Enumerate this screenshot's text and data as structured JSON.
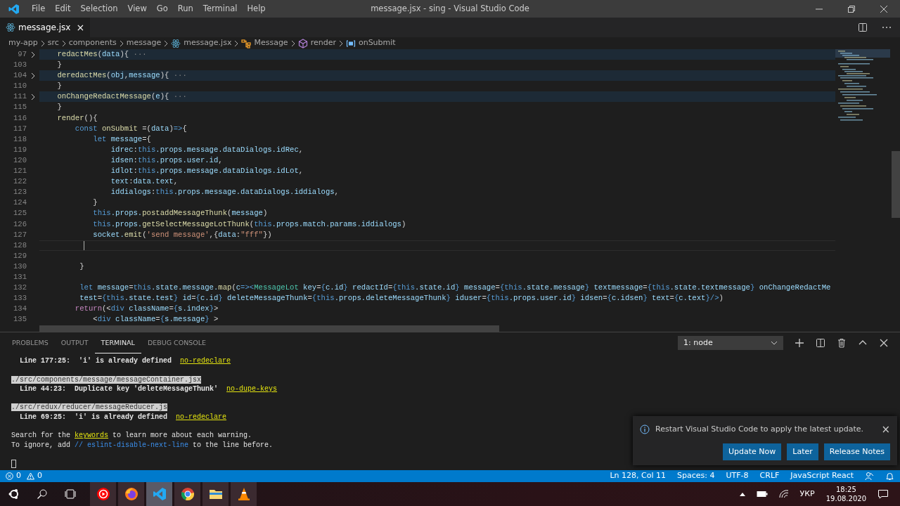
{
  "window": {
    "title": "message.jsx - sing - Visual Studio Code"
  },
  "menu": [
    "File",
    "Edit",
    "Selection",
    "View",
    "Go",
    "Run",
    "Terminal",
    "Help"
  ],
  "tabs": [
    {
      "label": "message.jsx",
      "selected": true,
      "close": "×"
    }
  ],
  "breadcrumbs": [
    {
      "label": "my-app"
    },
    {
      "label": "src"
    },
    {
      "label": "components"
    },
    {
      "label": "message"
    },
    {
      "label": "message.jsx",
      "kind": "react"
    },
    {
      "label": "Message",
      "kind": "class"
    },
    {
      "label": "render",
      "kind": "method"
    },
    {
      "label": "onSubmit",
      "kind": "variable"
    }
  ],
  "code": [
    {
      "number": "97",
      "folded": true,
      "tokens": [
        {
          "kind": "fn",
          "text": "    redactMes"
        },
        {
          "kind": "p",
          "text": "("
        },
        {
          "kind": "var",
          "text": "data"
        },
        {
          "kind": "p",
          "text": "){"
        },
        {
          "kind": "dots",
          "text": " ···"
        }
      ]
    },
    {
      "number": "103",
      "folded": false,
      "tokens": [
        {
          "kind": "p",
          "text": "    }"
        }
      ]
    },
    {
      "number": "104",
      "folded": true,
      "tokens": [
        {
          "kind": "fn",
          "text": "    deredactMes"
        },
        {
          "kind": "p",
          "text": "("
        },
        {
          "kind": "var",
          "text": "obj"
        },
        {
          "kind": "p",
          "text": ","
        },
        {
          "kind": "var",
          "text": "message"
        },
        {
          "kind": "p",
          "text": "){"
        },
        {
          "kind": "dots",
          "text": " ···"
        }
      ]
    },
    {
      "number": "110",
      "folded": false,
      "tokens": [
        {
          "kind": "p",
          "text": "    }"
        }
      ]
    },
    {
      "number": "111",
      "folded": true,
      "tokens": [
        {
          "kind": "fn",
          "text": "    onChangeRedactMessage"
        },
        {
          "kind": "p",
          "text": "("
        },
        {
          "kind": "var",
          "text": "e"
        },
        {
          "kind": "p",
          "text": "){"
        },
        {
          "kind": "dots",
          "text": " ···"
        }
      ]
    },
    {
      "number": "115",
      "folded": false,
      "tokens": [
        {
          "kind": "p",
          "text": "    }"
        }
      ]
    },
    {
      "number": "116",
      "folded": false,
      "tokens": [
        {
          "kind": "fn",
          "text": "    render"
        },
        {
          "kind": "p",
          "text": "(){"
        }
      ]
    },
    {
      "number": "117",
      "folded": false,
      "tokens": [
        {
          "kind": "kw",
          "text": "        const"
        },
        {
          "kind": "fn",
          "text": " onSubmit"
        },
        {
          "kind": "p",
          "text": " =("
        },
        {
          "kind": "var",
          "text": "data"
        },
        {
          "kind": "p",
          "text": ")"
        },
        {
          "kind": "kw",
          "text": "=>"
        },
        {
          "kind": "p",
          "text": "{"
        }
      ]
    },
    {
      "number": "118",
      "folded": false,
      "tokens": [
        {
          "kind": "kw",
          "text": "            let"
        },
        {
          "kind": "var",
          "text": " message"
        },
        {
          "kind": "p",
          "text": "={"
        }
      ]
    },
    {
      "number": "119",
      "folded": false,
      "tokens": [
        {
          "kind": "var",
          "text": "                idrec"
        },
        {
          "kind": "p",
          "text": ":"
        },
        {
          "kind": "kw",
          "text": "this"
        },
        {
          "kind": "var",
          "text": ".props.message.dataDialogs.idRec"
        },
        {
          "kind": "p",
          "text": ","
        }
      ]
    },
    {
      "number": "120",
      "folded": false,
      "tokens": [
        {
          "kind": "var",
          "text": "                idsen"
        },
        {
          "kind": "p",
          "text": ":"
        },
        {
          "kind": "kw",
          "text": "this"
        },
        {
          "kind": "var",
          "text": ".props.user.id"
        },
        {
          "kind": "p",
          "text": ","
        }
      ]
    },
    {
      "number": "121",
      "folded": false,
      "tokens": [
        {
          "kind": "var",
          "text": "                idlot"
        },
        {
          "kind": "p",
          "text": ":"
        },
        {
          "kind": "kw",
          "text": "this"
        },
        {
          "kind": "var",
          "text": ".props.message.dataDialogs.idLot"
        },
        {
          "kind": "p",
          "text": ","
        }
      ]
    },
    {
      "number": "122",
      "folded": false,
      "tokens": [
        {
          "kind": "var",
          "text": "                text"
        },
        {
          "kind": "p",
          "text": ":"
        },
        {
          "kind": "var",
          "text": "data.text"
        },
        {
          "kind": "p",
          "text": ","
        }
      ]
    },
    {
      "number": "123",
      "folded": false,
      "tokens": [
        {
          "kind": "var",
          "text": "                iddialogs"
        },
        {
          "kind": "p",
          "text": ":"
        },
        {
          "kind": "kw",
          "text": "this"
        },
        {
          "kind": "var",
          "text": ".props.message.dataDialogs.iddialogs"
        },
        {
          "kind": "p",
          "text": ","
        }
      ]
    },
    {
      "number": "124",
      "folded": false,
      "tokens": [
        {
          "kind": "p",
          "text": "            }"
        }
      ]
    },
    {
      "number": "125",
      "folded": false,
      "tokens": [
        {
          "kind": "kw",
          "text": "            this"
        },
        {
          "kind": "var",
          "text": ".props."
        },
        {
          "kind": "fn",
          "text": "postaddMessageThunk"
        },
        {
          "kind": "p",
          "text": "("
        },
        {
          "kind": "var",
          "text": "message"
        },
        {
          "kind": "p",
          "text": ")"
        }
      ]
    },
    {
      "number": "126",
      "folded": false,
      "tokens": [
        {
          "kind": "kw",
          "text": "            this"
        },
        {
          "kind": "var",
          "text": ".props."
        },
        {
          "kind": "fn",
          "text": "getSelectMessageLotThunk"
        },
        {
          "kind": "p",
          "text": "("
        },
        {
          "kind": "kw",
          "text": "this"
        },
        {
          "kind": "var",
          "text": ".props.match.params.iddialogs"
        },
        {
          "kind": "p",
          "text": ")"
        }
      ]
    },
    {
      "number": "127",
      "folded": false,
      "tokens": [
        {
          "kind": "var",
          "text": "            socket."
        },
        {
          "kind": "fn",
          "text": "emit"
        },
        {
          "kind": "p",
          "text": "("
        },
        {
          "kind": "str",
          "text": "'send message'"
        },
        {
          "kind": "p",
          "text": ",{"
        },
        {
          "kind": "var",
          "text": "data"
        },
        {
          "kind": "p",
          "text": ":"
        },
        {
          "kind": "str",
          "text": "\"fff\""
        },
        {
          "kind": "p",
          "text": "})"
        }
      ]
    },
    {
      "number": "128",
      "folded": false,
      "current": true
    },
    {
      "number": "129",
      "folded": false
    },
    {
      "number": "130",
      "folded": false,
      "tokens": [
        {
          "kind": "p",
          "text": "         }"
        }
      ]
    },
    {
      "number": "131",
      "folded": false
    },
    {
      "number": "132",
      "folded": false,
      "tokens": [
        {
          "kind": "kw",
          "text": "         let"
        },
        {
          "kind": "var",
          "text": " message"
        },
        {
          "kind": "p",
          "text": "="
        },
        {
          "kind": "kw",
          "text": "this"
        },
        {
          "kind": "var",
          "text": ".state.message."
        },
        {
          "kind": "fn",
          "text": "map"
        },
        {
          "kind": "p",
          "text": "("
        },
        {
          "kind": "var",
          "text": "c"
        },
        {
          "kind": "kw",
          "text": "=><"
        },
        {
          "kind": "tag",
          "text": "MessageLot"
        },
        {
          "kind": "var",
          "text": " key"
        },
        {
          "kind": "p",
          "text": "="
        },
        {
          "kind": "kw",
          "text": "{"
        },
        {
          "kind": "var",
          "text": "c.id"
        },
        {
          "kind": "kw",
          "text": "}"
        },
        {
          "kind": "var",
          "text": " redactId"
        },
        {
          "kind": "p",
          "text": "="
        },
        {
          "kind": "kw",
          "text": "{this"
        },
        {
          "kind": "var",
          "text": ".state.id"
        },
        {
          "kind": "kw",
          "text": "}"
        },
        {
          "kind": "var",
          "text": " message"
        },
        {
          "kind": "p",
          "text": "="
        },
        {
          "kind": "kw",
          "text": "{this"
        },
        {
          "kind": "var",
          "text": ".state.message"
        },
        {
          "kind": "kw",
          "text": "}"
        },
        {
          "kind": "var",
          "text": " textmessage"
        },
        {
          "kind": "p",
          "text": "="
        },
        {
          "kind": "kw",
          "text": "{this"
        },
        {
          "kind": "var",
          "text": ".state.textmessage"
        },
        {
          "kind": "kw",
          "text": "}"
        },
        {
          "kind": "var",
          "text": " onChangeRedactMe"
        }
      ]
    },
    {
      "number": "133",
      "folded": false,
      "tokens": [
        {
          "kind": "var",
          "text": "         test"
        },
        {
          "kind": "p",
          "text": "="
        },
        {
          "kind": "kw",
          "text": "{this"
        },
        {
          "kind": "var",
          "text": ".state.test"
        },
        {
          "kind": "kw",
          "text": "}"
        },
        {
          "kind": "var",
          "text": " id"
        },
        {
          "kind": "p",
          "text": "="
        },
        {
          "kind": "kw",
          "text": "{"
        },
        {
          "kind": "var",
          "text": "c.id"
        },
        {
          "kind": "kw",
          "text": "}"
        },
        {
          "kind": "var",
          "text": " deleteMessageThunk"
        },
        {
          "kind": "p",
          "text": "="
        },
        {
          "kind": "kw",
          "text": "{this"
        },
        {
          "kind": "var",
          "text": ".props.deleteMessageThunk"
        },
        {
          "kind": "kw",
          "text": "}"
        },
        {
          "kind": "var",
          "text": " iduser"
        },
        {
          "kind": "p",
          "text": "="
        },
        {
          "kind": "kw",
          "text": "{this"
        },
        {
          "kind": "var",
          "text": ".props.user.id"
        },
        {
          "kind": "kw",
          "text": "}"
        },
        {
          "kind": "var",
          "text": " idsen"
        },
        {
          "kind": "p",
          "text": "="
        },
        {
          "kind": "kw",
          "text": "{"
        },
        {
          "kind": "var",
          "text": "c.idsen"
        },
        {
          "kind": "kw",
          "text": "}"
        },
        {
          "kind": "var",
          "text": " text"
        },
        {
          "kind": "p",
          "text": "="
        },
        {
          "kind": "kw",
          "text": "{"
        },
        {
          "kind": "var",
          "text": "c.text"
        },
        {
          "kind": "kw",
          "text": "}/>"
        },
        {
          "kind": "p",
          "text": ")"
        }
      ]
    },
    {
      "number": "134",
      "folded": false,
      "tokens": [
        {
          "kind": "ctl",
          "text": "        return"
        },
        {
          "kind": "p",
          "text": "(<"
        },
        {
          "kind": "kw",
          "text": "div"
        },
        {
          "kind": "var",
          "text": " className"
        },
        {
          "kind": "p",
          "text": "="
        },
        {
          "kind": "kw",
          "text": "{"
        },
        {
          "kind": "var",
          "text": "s.index"
        },
        {
          "kind": "kw",
          "text": "}"
        },
        {
          "kind": "p",
          "text": ">"
        }
      ]
    },
    {
      "number": "135",
      "folded": false,
      "tokens": [
        {
          "kind": "p",
          "text": "            <"
        },
        {
          "kind": "kw",
          "text": "div"
        },
        {
          "kind": "var",
          "text": " className"
        },
        {
          "kind": "p",
          "text": "="
        },
        {
          "kind": "kw",
          "text": "{"
        },
        {
          "kind": "var",
          "text": "s.message"
        },
        {
          "kind": "kw",
          "text": "}"
        },
        {
          "kind": "p",
          "text": " >"
        }
      ]
    }
  ],
  "panel": {
    "tabs": [
      {
        "label": "PROBLEMS",
        "selected": false
      },
      {
        "label": "OUTPUT",
        "selected": false
      },
      {
        "label": "TERMINAL",
        "selected": true
      },
      {
        "label": "DEBUG CONSOLE",
        "selected": false
      }
    ],
    "terminal_select": {
      "value": "1: node"
    },
    "terminal": [
      [
        [
          {
            "kind": "bold",
            "text": "  Line 177:25:  'i' is already defined  "
          },
          {
            "kind": "link",
            "text": "no-redeclare"
          }
        ]
      ],
      [
        [
          {
            "kind": "path",
            "text": "./src/components/message/messageContainer.jsx"
          }
        ],
        [
          {
            "kind": "bold",
            "text": "  Line 44:23:  Duplicate key 'deleteMessageThunk'  "
          },
          {
            "kind": "link",
            "text": "no-dupe-keys"
          }
        ]
      ],
      [
        [
          {
            "kind": "path",
            "text": "./src/redux/reducer/messageReducer.js"
          }
        ],
        [
          {
            "kind": "bold",
            "text": "  Line 69:25:  'i' is already defined  "
          },
          {
            "kind": "link",
            "text": "no-redeclare"
          }
        ]
      ],
      [
        [
          {
            "kind": "text",
            "text": "Search for the "
          },
          {
            "kind": "link",
            "text": "keywords"
          },
          {
            "kind": "text",
            "text": " to learn more about each warning."
          }
        ],
        [
          {
            "kind": "text",
            "text": "To ignore, add "
          },
          {
            "kind": "code",
            "text": "// eslint-disable-next-line"
          },
          {
            "kind": "text",
            "text": " to the line before."
          }
        ]
      ],
      [
        [
          {
            "kind": "cursor"
          }
        ]
      ]
    ]
  },
  "notification": {
    "message": "Restart Visual Studio Code to apply the latest update.",
    "close": "×",
    "buttons": [
      "Update Now",
      "Later",
      "Release Notes"
    ]
  },
  "status_bar": {
    "left": [
      {
        "kind": "error",
        "text": "0"
      },
      {
        "kind": "warning",
        "text": "0"
      }
    ],
    "right": [
      "Ln 128, Col 11",
      "Spaces: 4",
      "UTF-8",
      "CRLF",
      "JavaScript React"
    ]
  },
  "taskbar": {
    "apps": [
      {
        "kind": "media",
        "selected": false
      },
      {
        "kind": "firefox",
        "selected": false
      },
      {
        "kind": "vscode",
        "selected": true
      },
      {
        "kind": "chrome",
        "selected": false
      },
      {
        "kind": "files",
        "selected": false
      },
      {
        "kind": "vlc",
        "selected": false
      }
    ],
    "language": "УКР",
    "time": "18:25",
    "date": "19.08.2020"
  }
}
